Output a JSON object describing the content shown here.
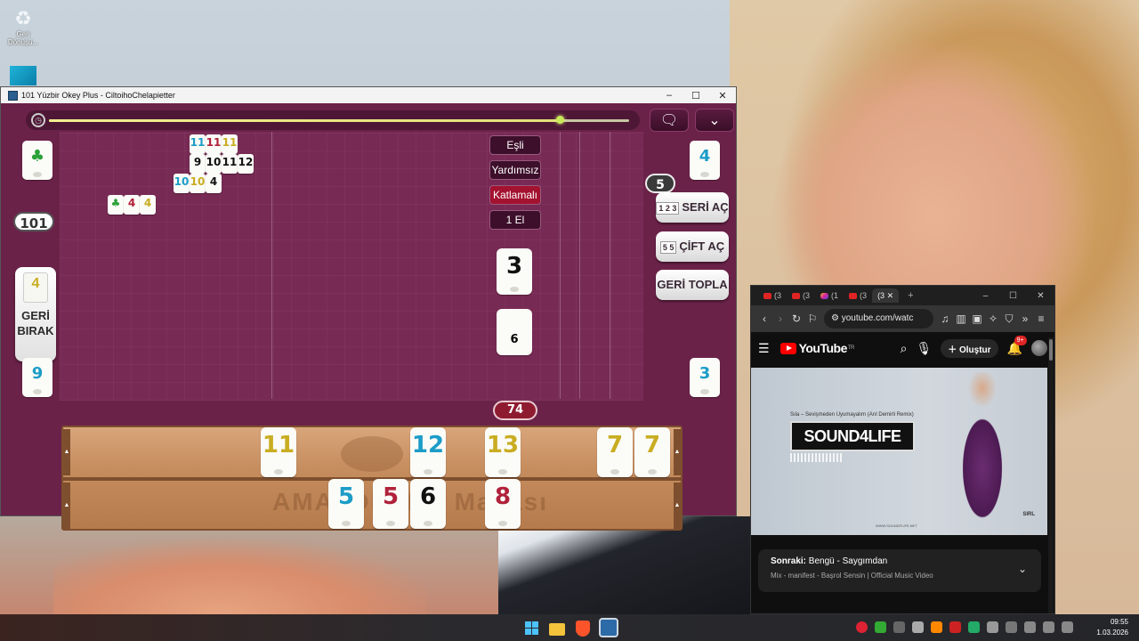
{
  "desktop": {
    "recycle_label": "Geri Dönüşü..."
  },
  "game_window": {
    "title": "101 Yüzbir Okey Plus - CiltoihoChelapietter",
    "controls": {
      "minimize": "–",
      "maximize": "☐",
      "close": "✕"
    },
    "timer_progress": 0.88,
    "chat_icon": "chat-icon",
    "collapse_icon": "chevron-down-icon",
    "left_player": {
      "indicator_tile": {
        "symbol": "♣",
        "color": "#2aa038"
      },
      "score": "101",
      "discard_tile": {
        "value": "4",
        "color": "#c9ad22"
      },
      "discard_label_line1": "GERİ",
      "discard_label_line2": "BIRAK",
      "bottom_tile": {
        "value": "9",
        "color": "#1c9cc8"
      }
    },
    "right_player": {
      "top_tile": {
        "value": "4",
        "color": "#1c9cc8"
      },
      "tile_count": "5",
      "bottom_tile": {
        "value": "3",
        "color": "#1c9cc8"
      }
    },
    "table_sets": [
      {
        "tiles": [
          {
            "v": "11",
            "c": "blue"
          },
          {
            "v": "11",
            "c": "red"
          },
          {
            "v": "11",
            "c": "yellow"
          }
        ]
      },
      {
        "tiles": [
          {
            "v": "9",
            "c": "black"
          },
          {
            "v": "10",
            "c": "black"
          },
          {
            "v": "11",
            "c": "black"
          },
          {
            "v": "12",
            "c": "black"
          }
        ]
      },
      {
        "tiles": [
          {
            "v": "10",
            "c": "blue"
          },
          {
            "v": "10",
            "c": "yellow"
          },
          {
            "v": "4",
            "c": "black"
          }
        ]
      },
      {
        "tiles": [
          {
            "v": "♣",
            "c": "green"
          },
          {
            "v": "4",
            "c": "red"
          },
          {
            "v": "4",
            "c": "yellow"
          }
        ]
      }
    ],
    "modes": [
      "Eşli",
      "Yardımsız",
      "Katlamalı",
      "1 El"
    ],
    "active_mode": "Katlamalı",
    "center_tile": {
      "value": "3",
      "color": "#111111"
    },
    "pile_tile_number": "6",
    "pile_count": "74",
    "actions": {
      "series_open": "SERİ AÇ",
      "series_icon": "1 2 3",
      "pairs_open": "ÇİFT AÇ",
      "pairs_icon": "5 5",
      "collect_back": "GERİ TOPLA"
    },
    "rack": {
      "watermark": "AMATÖRLER Masası",
      "row1": [
        {
          "v": "11",
          "c": "yellow"
        },
        {
          "v": "12",
          "c": "blue"
        },
        {
          "v": "13",
          "c": "yellow"
        },
        {
          "v": "7",
          "c": "yellow"
        },
        {
          "v": "7",
          "c": "yellow"
        }
      ],
      "row2": [
        {
          "v": "5",
          "c": "blue"
        },
        {
          "v": "5",
          "c": "red"
        },
        {
          "v": "6",
          "c": "black"
        },
        {
          "v": "8",
          "c": "red"
        }
      ]
    }
  },
  "browser": {
    "url": "youtube.com/watc",
    "tabs": [
      "(3",
      "(3",
      "(1",
      "(3",
      "(3"
    ],
    "new_tab": "+",
    "youtube": {
      "logo": "YouTube",
      "region": "TR",
      "create_label": "Oluştur",
      "notifications": "9+"
    },
    "video": {
      "subtitle": "Sıla – Sevişmeden Uyumayalım (Arıl Demirli Remix)",
      "brand": "SOUND4LIFE",
      "site": "WWW.SOUNDFLIFE.NET",
      "mark": "SIRL"
    },
    "up_next": {
      "prefix": "Sonraki:",
      "title": "Bengü - Saygımdan",
      "playlist": "Mix - manifest - Başrol Sensin | Official Music Video"
    }
  },
  "taskbar": {
    "time": "09:55",
    "date": "1.03.2026"
  }
}
